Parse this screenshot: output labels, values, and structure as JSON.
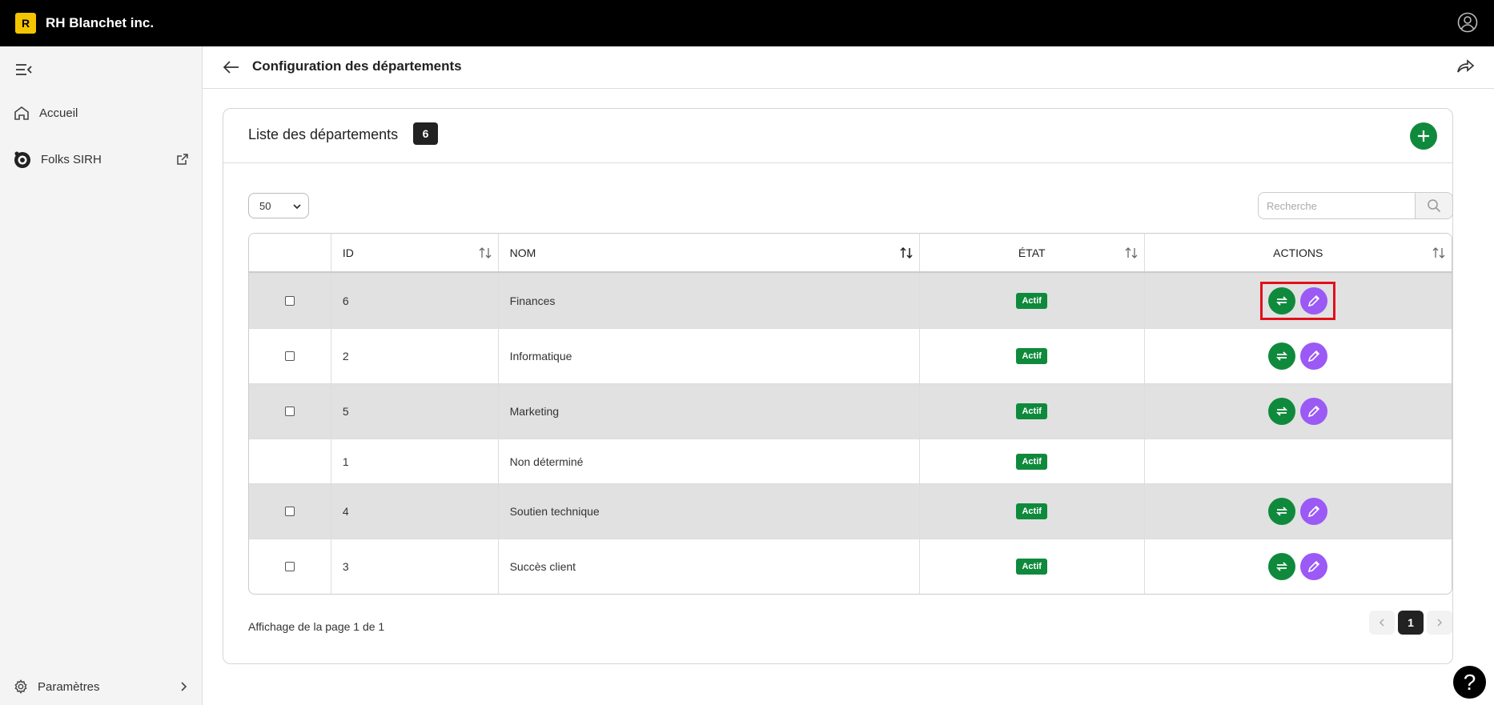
{
  "topbar": {
    "logo_letter": "R",
    "title": "RH Blanchet inc.",
    "logo_color": "#f5c400"
  },
  "sidebar": {
    "items": [
      {
        "label": "Accueil",
        "icon": "home-icon"
      },
      {
        "label": "Folks SIRH",
        "icon": "folks-logo-icon"
      }
    ],
    "settings_label": "Paramètres"
  },
  "header": {
    "title": "Configuration des départements"
  },
  "card": {
    "title": "Liste des départements",
    "count": "6",
    "per_page": "50",
    "search_placeholder": "Recherche"
  },
  "table": {
    "columns": [
      "ID",
      "NOM",
      "ÉTAT",
      "ACTIONS"
    ],
    "rows": [
      {
        "id": "6",
        "nom": "Finances",
        "etat": "Actif",
        "checkbox": true,
        "actions": true
      },
      {
        "id": "2",
        "nom": "Informatique",
        "etat": "Actif",
        "checkbox": true,
        "actions": true
      },
      {
        "id": "5",
        "nom": "Marketing",
        "etat": "Actif",
        "checkbox": true,
        "actions": true
      },
      {
        "id": "1",
        "nom": "Non déterminé",
        "etat": "Actif",
        "checkbox": false,
        "actions": false
      },
      {
        "id": "4",
        "nom": "Soutien technique",
        "etat": "Actif",
        "checkbox": true,
        "actions": true
      },
      {
        "id": "3",
        "nom": "Succès client",
        "etat": "Actif",
        "checkbox": true,
        "actions": true
      }
    ]
  },
  "footer": {
    "page_info": "Affichage de la page 1 de 1",
    "current_page": "1"
  },
  "help": {
    "label": "?"
  },
  "colors": {
    "accent_green": "#0f8a3c",
    "edit_purple": "#9b59f5",
    "highlight": "#e0101a"
  }
}
